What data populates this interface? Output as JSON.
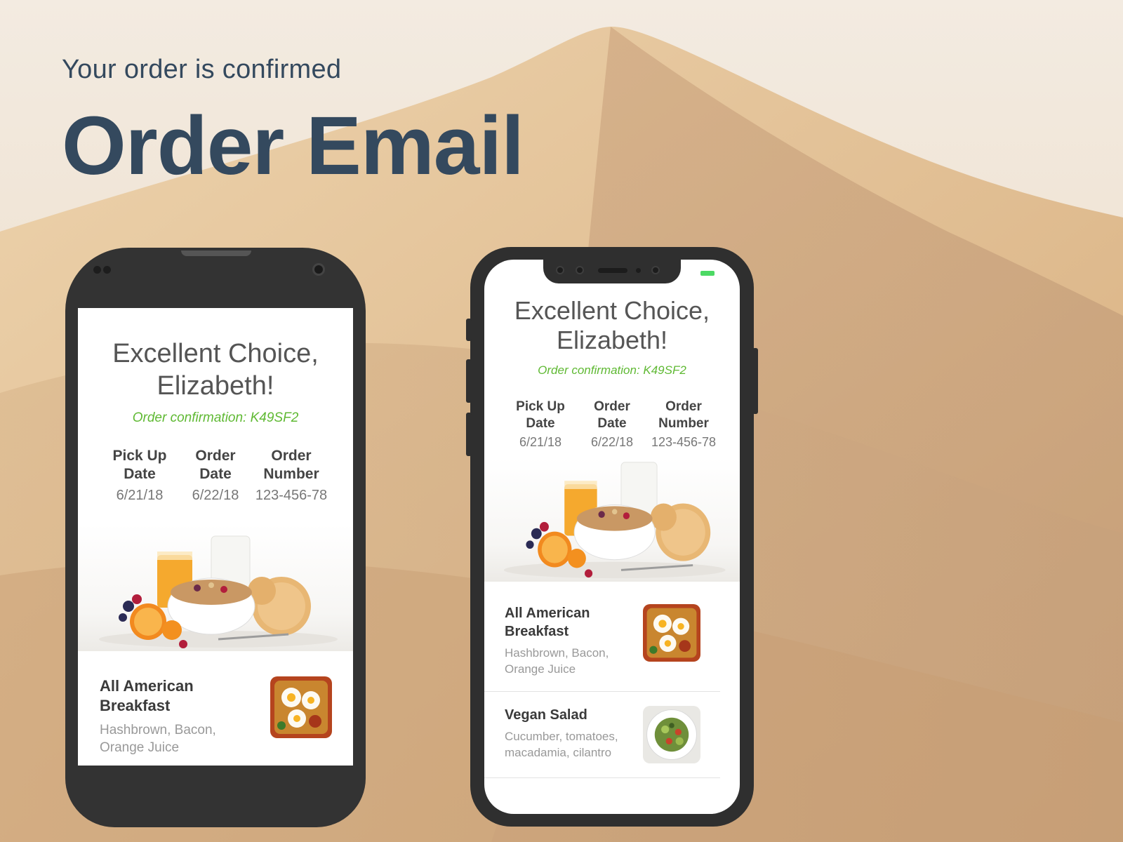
{
  "header": {
    "subtitle": "Your order is confirmed",
    "title": "Order Email"
  },
  "email": {
    "greeting_line1": "Excellent Choice,",
    "greeting_line2": "Elizabeth!",
    "confirmation": "Order confirmation: K49SF2",
    "info": [
      {
        "label_line1": "Pick Up",
        "label_line2": "Date",
        "value": "6/21/18"
      },
      {
        "label_line1": "Order",
        "label_line2": "Date",
        "value": "6/22/18"
      },
      {
        "label_line1": "Order",
        "label_line2": "Number",
        "value": "123-456-78"
      }
    ],
    "items": [
      {
        "name_line1": "All American",
        "name_line2": "Breakfast",
        "desc_line1": "Hashbrown, Bacon,",
        "desc_line2": "Orange Juice"
      },
      {
        "name_line1": "Vegan Salad",
        "name_line2": "",
        "desc_line1": "Cucumber, tomatoes,",
        "desc_line2": "macadamia, cilantro"
      }
    ]
  },
  "colors": {
    "heading": "#34495e",
    "confirmation_green": "#5fb933",
    "phone_body": "#333333",
    "battery": "#4cd964"
  }
}
